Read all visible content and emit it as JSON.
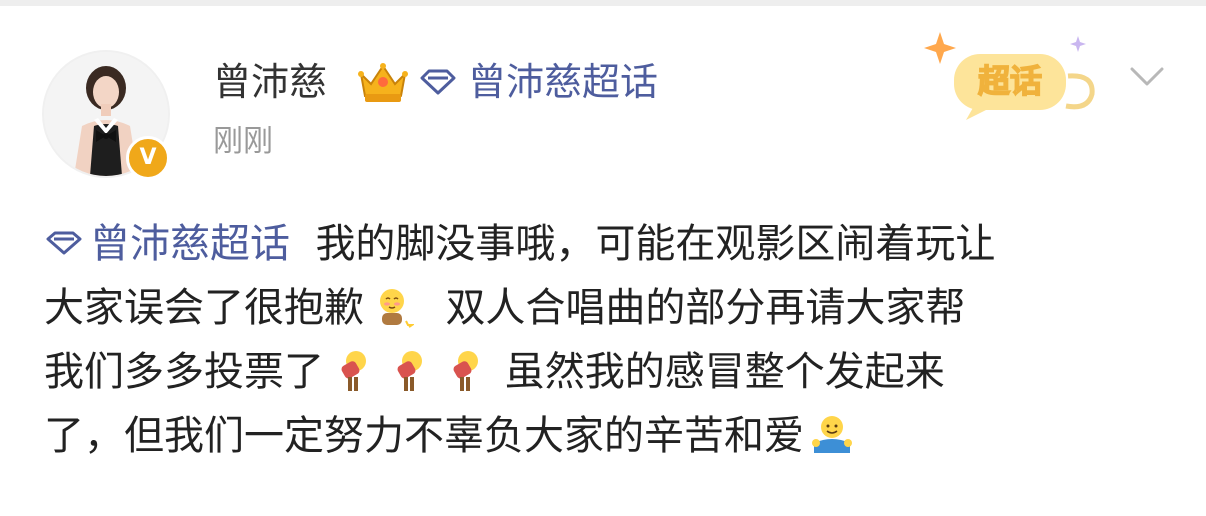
{
  "post": {
    "author": {
      "name": "曾沛慈",
      "avatar_alt": "avatar",
      "verified_badge": "V",
      "member_icon": "crown-icon"
    },
    "supertopic_link": {
      "icon": "diamond-icon",
      "label": "曾沛慈超话"
    },
    "timestamp": "刚刚",
    "badge": {
      "label": "超话"
    },
    "content": {
      "topic_label": "曾沛慈超话",
      "line1": "我的脚没事哦，可能在观影区闹着玩让",
      "line2_a": "大家误会了很抱歉",
      "line2_b": "双人合唱曲的部分再请大家帮",
      "line3_a": "我们多多投票了",
      "line3_b": "虽然我的感冒整个发起来",
      "line4": "了，但我们一定努力不辜负大家的辛苦和爱"
    },
    "emojis": {
      "shy": "shy-emoji",
      "bow": "bow-emoji",
      "hug": "hug-emoji"
    }
  },
  "colors": {
    "link": "#4e5d9e",
    "text": "#222222",
    "muted": "#999999",
    "badge_orange": "#f0a81a"
  }
}
